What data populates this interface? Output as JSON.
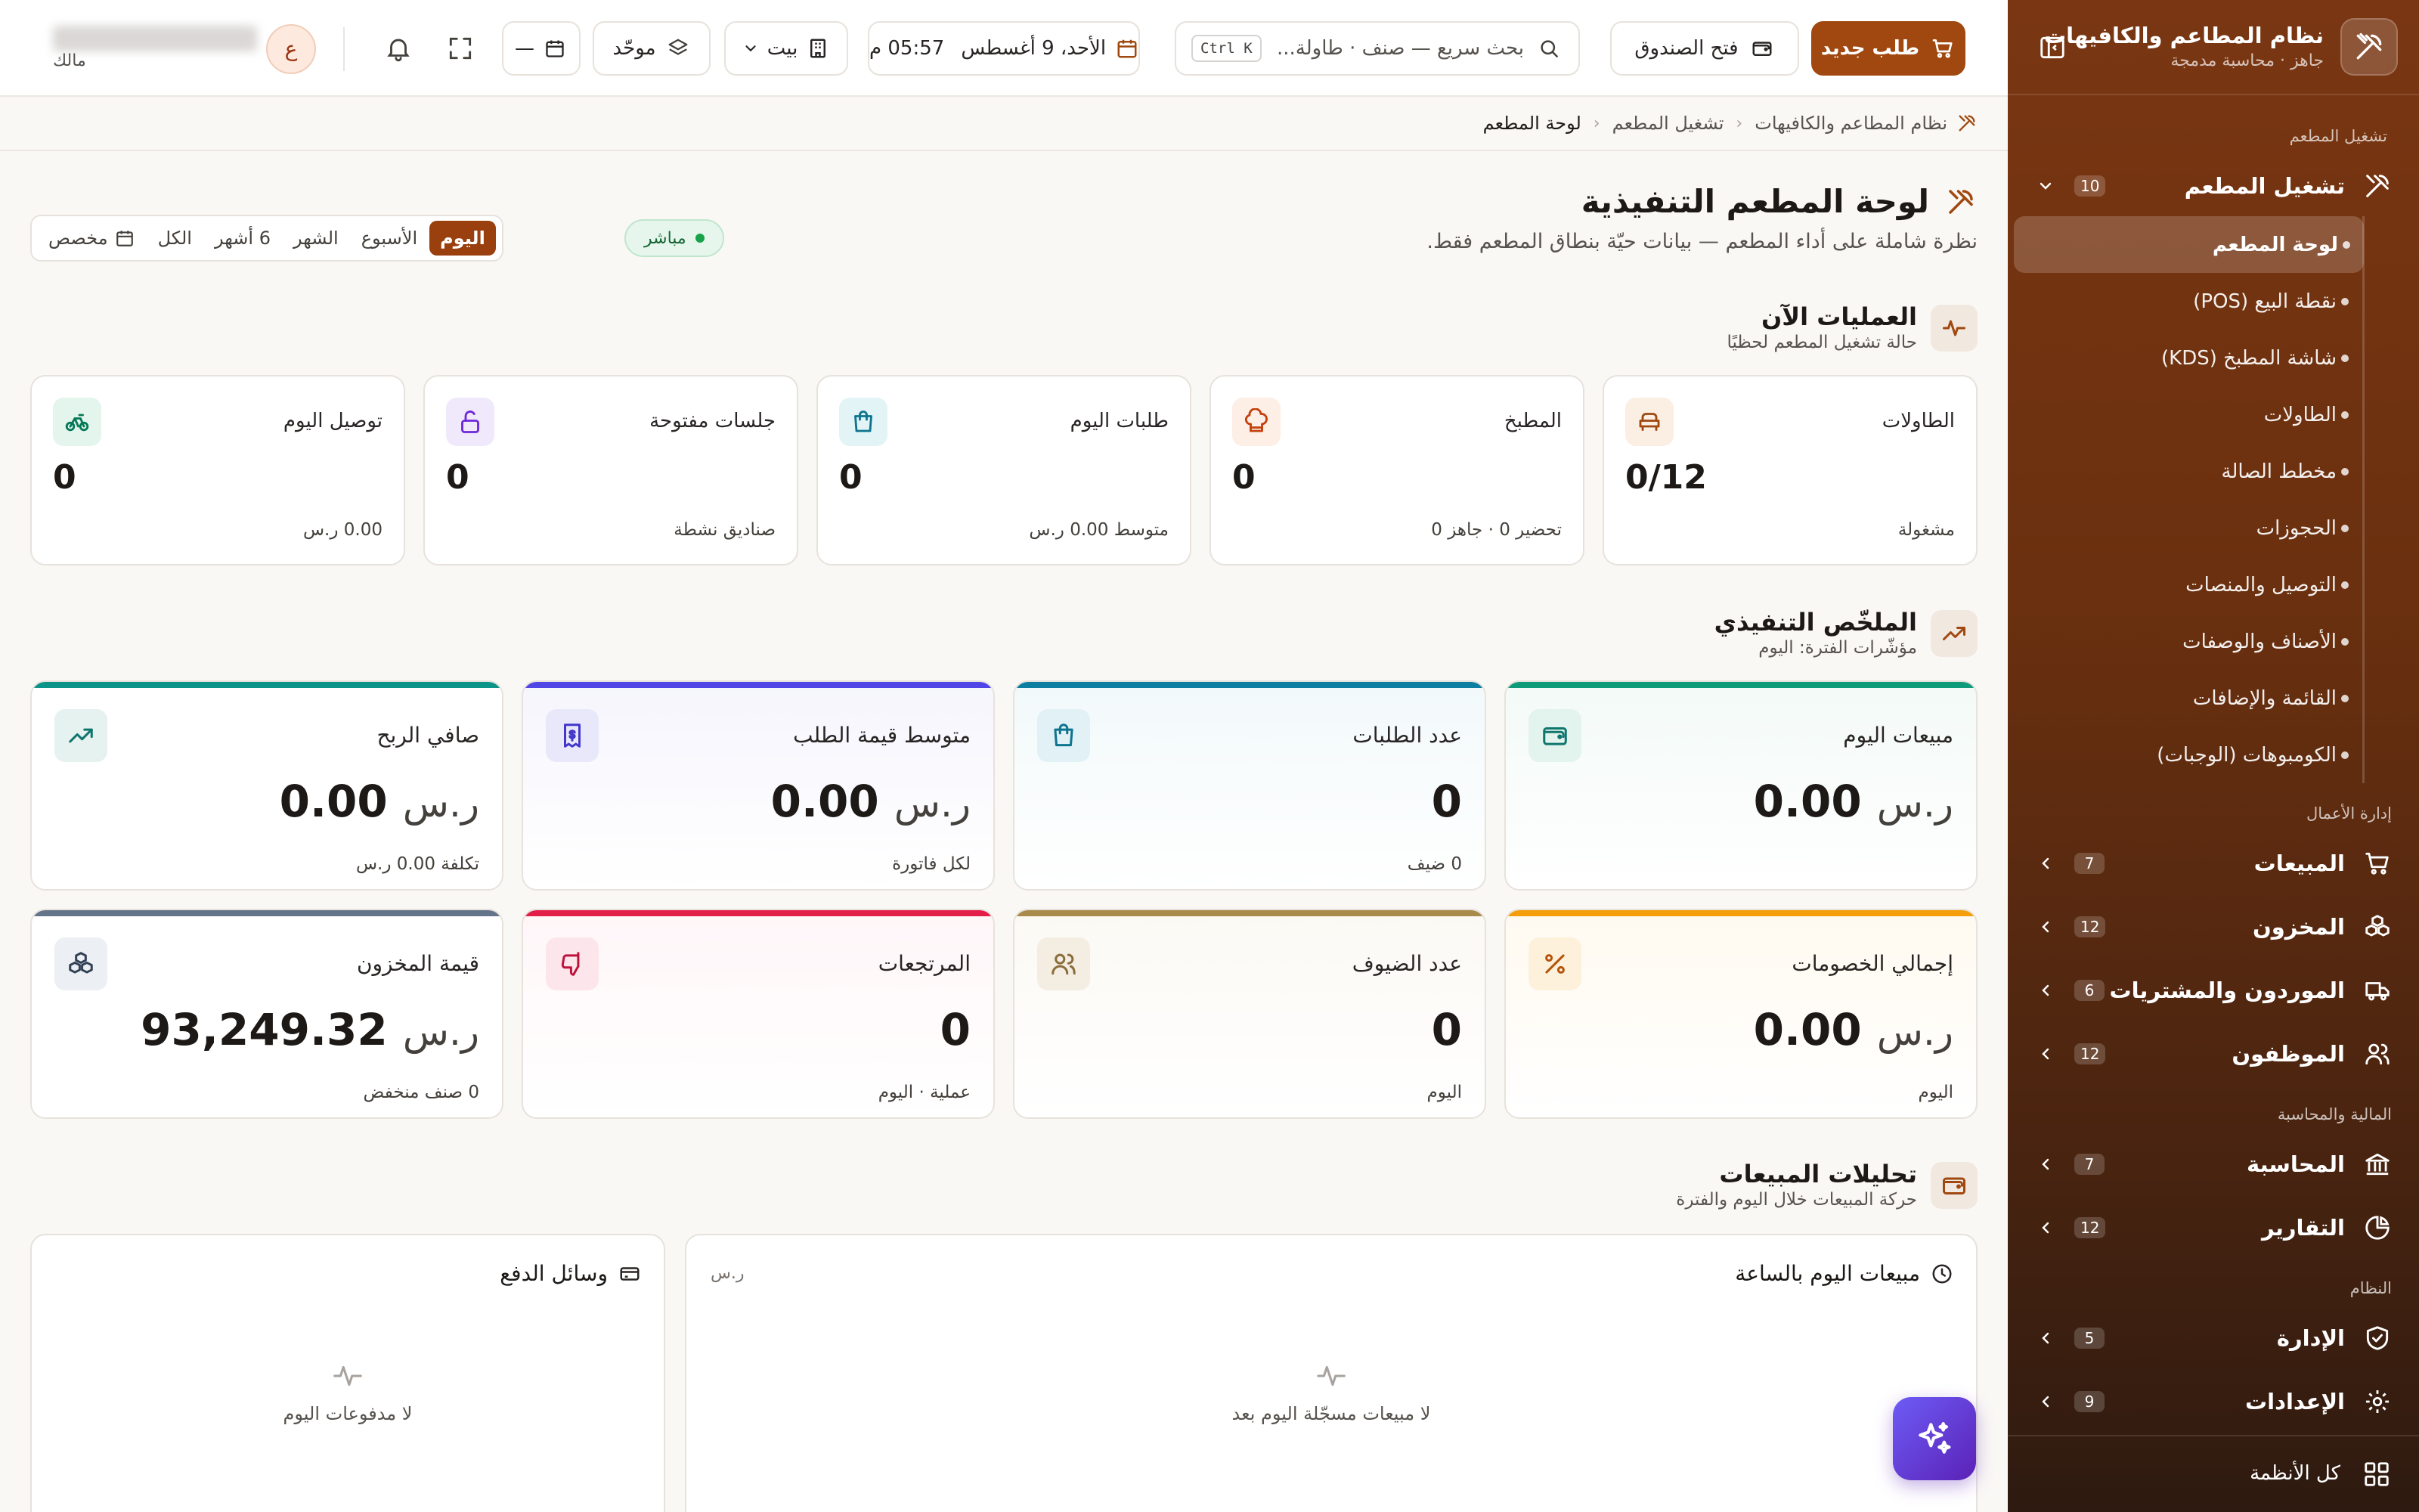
{
  "sidebar": {
    "title": "نظام المطاعم والكافيهات",
    "subtitle": "جاهز · محاسبة مدمجة",
    "sections": {
      "operations": "تشغيل المطعم",
      "business": "إدارة الأعمال",
      "finance": "المالية والمحاسبة",
      "system": "النظام"
    },
    "operations_group": {
      "label": "تشغيل المطعم",
      "badge": "10"
    },
    "operations_items": [
      {
        "label": "لوحة المطعم"
      },
      {
        "label": "نقطة البيع (POS)"
      },
      {
        "label": "شاشة المطبخ (KDS)"
      },
      {
        "label": "الطاولات"
      },
      {
        "label": "مخطط الصالة"
      },
      {
        "label": "الحجوزات"
      },
      {
        "label": "التوصيل والمنصات"
      },
      {
        "label": "الأصناف والوصفات"
      },
      {
        "label": "القائمة والإضافات"
      },
      {
        "label": "الكومبوهات (الوجبات)"
      }
    ],
    "groups": {
      "sales": {
        "label": "المبيعات",
        "badge": "7"
      },
      "inventory": {
        "label": "المخزون",
        "badge": "12"
      },
      "suppliers": {
        "label": "الموردون والمشتريات",
        "badge": "6"
      },
      "employees": {
        "label": "الموظفون",
        "badge": "12"
      },
      "accounting": {
        "label": "المحاسبة",
        "badge": "7"
      },
      "reports": {
        "label": "التقارير",
        "badge": "12"
      },
      "admin": {
        "label": "الإدارة",
        "badge": "5"
      },
      "settings": {
        "label": "الإعدادات",
        "badge": "9"
      }
    },
    "all_systems": "كل الأنظمة"
  },
  "topbar": {
    "new_order": "طلب جديد",
    "open_cash": "فتح الصندوق",
    "search_placeholder": "بحث سريع — صنف · طاولة...",
    "search_shortcut": "Ctrl K",
    "date": "الأحد، 9 أغسطس",
    "time": "05:57 م",
    "branch": "بيت",
    "mode": "موحّد",
    "date_filter": "—",
    "avatar_initial": "ع",
    "user_role": "مالك"
  },
  "breadcrumb": [
    "نظام المطاعم والكافيهات",
    "تشغيل المطعم",
    "لوحة المطعم"
  ],
  "page": {
    "title": "لوحة المطعم التنفيذية",
    "description": "نظرة شاملة على أداء المطعم — بيانات حيّة بنطاق المطعم فقط.",
    "live": "مباشر",
    "periods": [
      {
        "label": "اليوم",
        "active": true
      },
      {
        "label": "الأسبوع",
        "active": false
      },
      {
        "label": "الشهر",
        "active": false
      },
      {
        "label": "6 أشهر",
        "active": false
      },
      {
        "label": "الكل",
        "active": false
      },
      {
        "label": "مخصص",
        "active": false
      }
    ]
  },
  "operations_now": {
    "title": "العمليات الآن",
    "subtitle": "حالة تشغيل المطعم لحظيًا",
    "cards": [
      {
        "label": "الطاولات",
        "value": "0/12",
        "sub": "مشغولة",
        "icon": "armchair-icon",
        "color": "#a0480f",
        "bg": "#fbeee3"
      },
      {
        "label": "المطبخ",
        "value": "0",
        "sub": "تحضير 0 · جاهز 0",
        "icon": "chef-hat-icon",
        "color": "#c2410c",
        "bg": "#fdeee6"
      },
      {
        "label": "طلبات اليوم",
        "value": "0",
        "sub": "متوسط 0.00 ر.س",
        "icon": "shopping-bag-icon",
        "color": "#0e7490",
        "bg": "#e3f4f7"
      },
      {
        "label": "جلسات مفتوحة",
        "value": "0",
        "sub": "صناديق نشطة",
        "icon": "lock-open-icon",
        "color": "#6d28d9",
        "bg": "#efe9fb"
      },
      {
        "label": "توصيل اليوم",
        "value": "0",
        "sub": "0.00 ر.س",
        "icon": "bike-icon",
        "color": "#047857",
        "bg": "#e3f5ec"
      }
    ]
  },
  "summary": {
    "title": "الملخّص التنفيذي",
    "subtitle": "مؤشّرات الفترة: اليوم",
    "kpis": [
      {
        "label": "مبيعات اليوم",
        "currency": "ر.س",
        "value": "0.00",
        "sub": "",
        "icon": "wallet-icon",
        "color": "#0f766e",
        "bar": "#0f9a7a",
        "bg": "#e3f3ee",
        "tint": "#f3faf7"
      },
      {
        "label": "عدد الطلبات",
        "currency": "",
        "value": "0",
        "sub": "0 ضيف",
        "icon": "shopping-bag-icon",
        "color": "#0e7490",
        "bar": "#0e7fa0",
        "bg": "#e1f1f6",
        "tint": "#f2f9fb"
      },
      {
        "label": "متوسط قيمة الطلب",
        "currency": "ر.س",
        "value": "0.00",
        "sub": "لكل فاتورة",
        "icon": "receipt-icon",
        "color": "#4338ca",
        "bar": "#4f46e5",
        "bg": "#e9e8fb",
        "tint": "#f6f5fd"
      },
      {
        "label": "صافي الربح",
        "currency": "ر.س",
        "value": "0.00",
        "sub": "تكلفة 0.00 ر.س",
        "icon": "trending-up-icon",
        "color": "#0f766e",
        "bar": "#0d9488",
        "bg": "#e6f2f0",
        "tint": "#ffffff"
      },
      {
        "label": "إجمالي الخصومات",
        "currency": "ر.س",
        "value": "0.00",
        "sub": "اليوم",
        "icon": "percent-icon",
        "color": "#b45309",
        "bar": "#f59e0b",
        "bg": "#fdf1dc",
        "tint": "#fffaf0"
      },
      {
        "label": "عدد الضيوف",
        "currency": "",
        "value": "0",
        "sub": "اليوم",
        "icon": "users-icon",
        "color": "#8a6d3b",
        "bar": "#a88b4a",
        "bg": "#f3ede2",
        "tint": "#fbf9f4"
      },
      {
        "label": "المرتجعات",
        "currency": "",
        "value": "0",
        "sub": "عملية · اليوم",
        "icon": "thumbs-down-icon",
        "color": "#be123c",
        "bar": "#e11d48",
        "bg": "#fde6eb",
        "tint": "#fff6f8"
      },
      {
        "label": "قيمة المخزون",
        "currency": "ر.س",
        "value": "93,249.32",
        "sub": "0 صنف منخفض",
        "icon": "boxes-icon",
        "color": "#334155",
        "bar": "#64748b",
        "bg": "#eceff3",
        "tint": "#ffffff"
      }
    ]
  },
  "sales_analytics": {
    "title": "تحليلات المبيعات",
    "subtitle": "حركة المبيعات خلال اليوم والفترة",
    "hourly": {
      "title": "مبيعات اليوم بالساعة",
      "unit": "ر.س",
      "empty": "لا مبيعات مسجّلة اليوم بعد"
    },
    "payments": {
      "title": "وسائل الدفع",
      "empty": "لا مدفوعات اليوم"
    }
  }
}
